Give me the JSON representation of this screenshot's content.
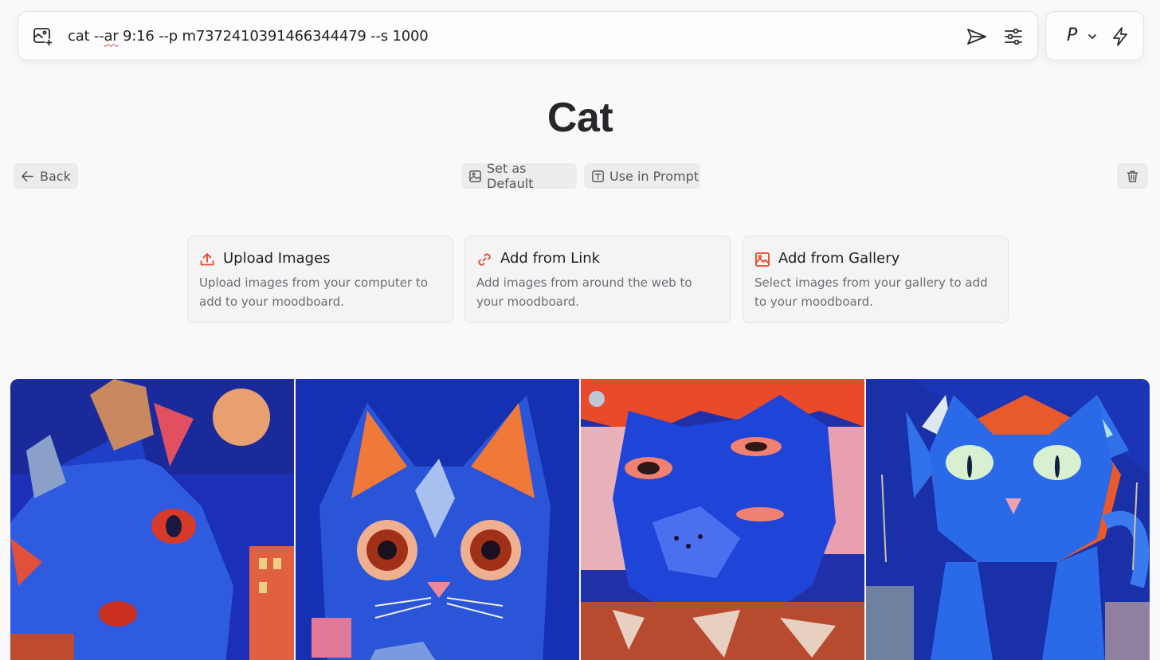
{
  "prompt_bar": {
    "text_before": "cat --",
    "text_underlined": "ar",
    "text_after": " 9:16 --p m7372410391466344479 --s 1000",
    "add_image_icon": "image-plus-icon",
    "send_icon": "send-icon",
    "settings_icon": "sliders-icon"
  },
  "mode": {
    "letter": "P",
    "chevron_icon": "chevron-down-icon",
    "bolt_icon": "lightning-icon"
  },
  "page": {
    "title": "Cat"
  },
  "actions": {
    "back_label": "Back",
    "set_default_label": "Set as Default",
    "use_in_prompt_label": "Use in Prompt",
    "delete_icon": "trash-icon"
  },
  "add_options": [
    {
      "title": "Upload Images",
      "description": "Upload images from your computer to add to your moodboard.",
      "icon": "upload-icon"
    },
    {
      "title": "Add from Link",
      "description": "Add images from around the web to your moodboard.",
      "icon": "link-icon"
    },
    {
      "title": "Add from Gallery",
      "description": "Select images from your gallery to add to your moodboard.",
      "icon": "gallery-icon"
    }
  ],
  "colors": {
    "accent": "#e8452c",
    "background": "#f9f9f9",
    "pill_bg": "#ececec",
    "card_bg": "#f4f4f4"
  },
  "gallery": [
    {
      "name": "cat-painting-1"
    },
    {
      "name": "cat-painting-2"
    },
    {
      "name": "cat-painting-3"
    },
    {
      "name": "cat-painting-4"
    }
  ]
}
